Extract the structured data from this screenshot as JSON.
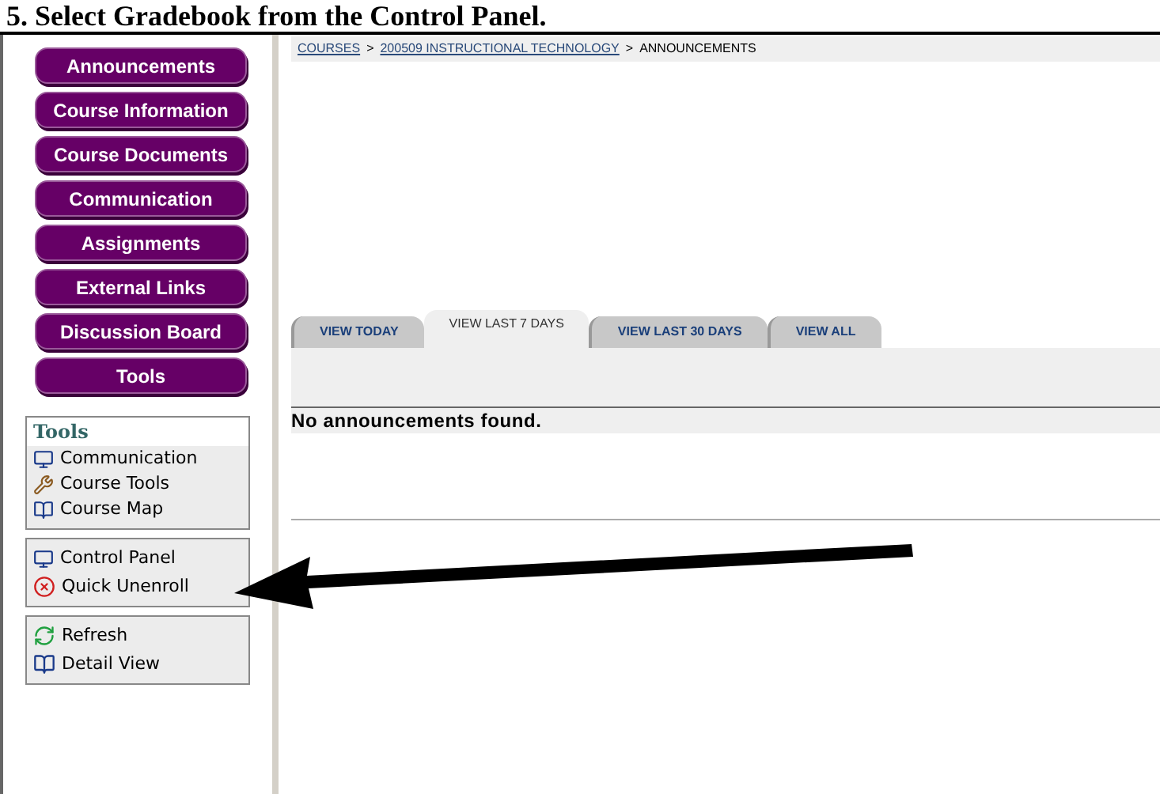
{
  "heading": "5. Select Gradebook from the Control Panel.",
  "nav_buttons": [
    "Announcements",
    "Course Information",
    "Course Documents",
    "Communication",
    "Assignments",
    "External Links",
    "Discussion Board",
    "Tools"
  ],
  "tools_panel": {
    "title": "Tools",
    "items": [
      {
        "label": "Communication",
        "kind": "monitor"
      },
      {
        "label": "Course Tools",
        "kind": "tools"
      },
      {
        "label": "Course Map",
        "kind": "map"
      }
    ]
  },
  "control_panel": {
    "items": [
      {
        "label": "Control Panel",
        "kind": "monitor"
      },
      {
        "label": "Quick Unenroll",
        "kind": "unenroll"
      }
    ]
  },
  "view_panel": {
    "items": [
      {
        "label": "Refresh",
        "kind": "refresh"
      },
      {
        "label": "Detail View",
        "kind": "detail"
      }
    ]
  },
  "breadcrumb": [
    {
      "label": "COURSES",
      "link": true
    },
    {
      "separator": ">",
      "label": "200509 INSTRUCTIONAL TECHNOLOGY",
      "link": true
    },
    {
      "separator": ">",
      "label": "ANNOUNCEMENTS",
      "link": false
    }
  ],
  "tabs": [
    {
      "label": "VIEW TODAY",
      "selected": false
    },
    {
      "label": "VIEW LAST 7 DAYS",
      "selected": true
    },
    {
      "label": "VIEW LAST 30 DAYS",
      "selected": false
    },
    {
      "label": "VIEW ALL",
      "selected": false
    }
  ],
  "message": "No announcements found."
}
